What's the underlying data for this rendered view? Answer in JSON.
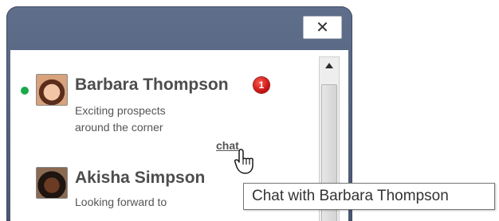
{
  "panel": {
    "close_label": "✕"
  },
  "contacts": [
    {
      "name": "Barbara Thompson",
      "status_lines": [
        "Exciting prospects",
        "around the corner"
      ],
      "unread_count": "1",
      "online": true,
      "chat_label": "chat"
    },
    {
      "name": "Akisha Simpson",
      "status_lines": [
        "Looking forward to"
      ],
      "online": false
    }
  ],
  "tooltip": {
    "text": "Chat with Barbara Thompson"
  },
  "colors": {
    "header": "#5f6f8b",
    "presence_online": "#19a94a",
    "badge": "#d21a1a"
  }
}
